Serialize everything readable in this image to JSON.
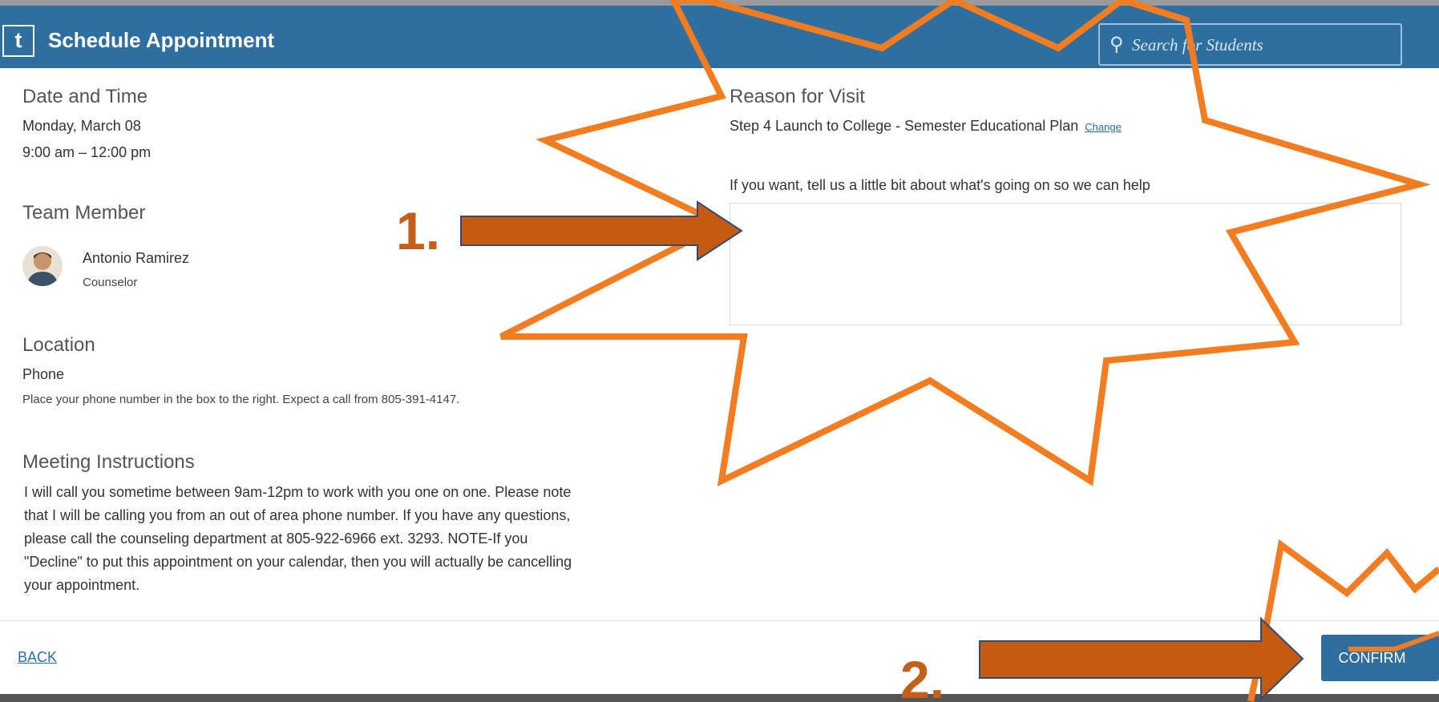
{
  "header": {
    "logo_letter": "t",
    "title": "Schedule Appointment",
    "search_placeholder": "Search for Students"
  },
  "date_time": {
    "heading": "Date and Time",
    "date": "Monday, March 08",
    "time": "9:00 am – 12:00 pm"
  },
  "team_member": {
    "heading": "Team Member",
    "name": "Antonio Ramirez",
    "role": "Counselor"
  },
  "location": {
    "heading": "Location",
    "type": "Phone",
    "note": "Place your phone number in the box to the right. Expect a call from 805-391-4147."
  },
  "meeting_instructions": {
    "heading": "Meeting Instructions",
    "lines": [
      "I will call you sometime between 9am-12pm to work with you one on one. Please note",
      "that I will be calling you from an out of area phone number. If you have any questions,",
      "please call the counseling department at 805-922-6966 ext. 3293. NOTE-If you",
      "\"Decline\" to put this appointment on your calendar, then you will actually be cancelling",
      "your appointment."
    ]
  },
  "reason": {
    "heading": "Reason for Visit",
    "value": "Step 4 Launch to College - Semester Educational Plan",
    "change_label": "Change"
  },
  "notes": {
    "label": "If you want, tell us a little bit about what's going on so we can help",
    "value": ""
  },
  "footer": {
    "back_label": "BACK",
    "confirm_label": "CONFIRM"
  },
  "annotations": {
    "step1": "1.",
    "step2": "2.",
    "burst_color": "#f47c20",
    "arrow_color": "#c55a11",
    "arrow_outline": "#2f4b7c"
  }
}
